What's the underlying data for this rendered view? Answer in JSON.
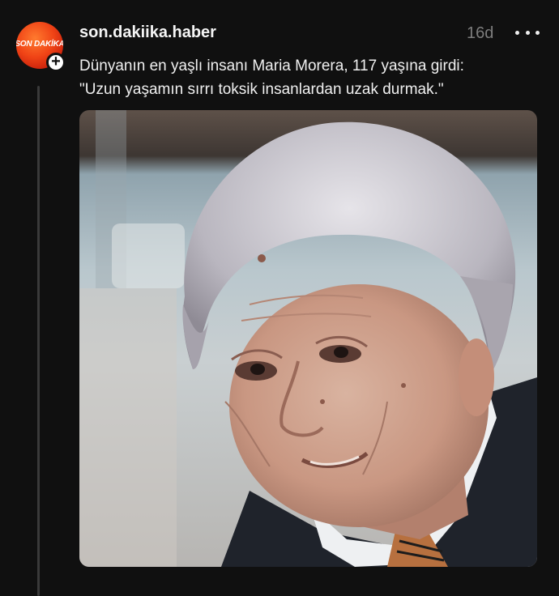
{
  "post": {
    "author": {
      "username": "son.dakiika.haber",
      "avatar_text": "SON DAKİKA",
      "follow_icon": "plus-icon"
    },
    "timestamp": "16d",
    "more_icon": "more-horizontal-icon",
    "caption": {
      "line1": "Dünyanın en yaşlı insanı Maria Morera, 117 yaşına girdi:",
      "line2": "\"Uzun yaşamın sırrı toksik insanlardan uzak durmak.\""
    }
  },
  "colors": {
    "background": "#101010",
    "text": "#f3f3f3",
    "muted": "#7d7d7d",
    "brand": "#f04416"
  }
}
